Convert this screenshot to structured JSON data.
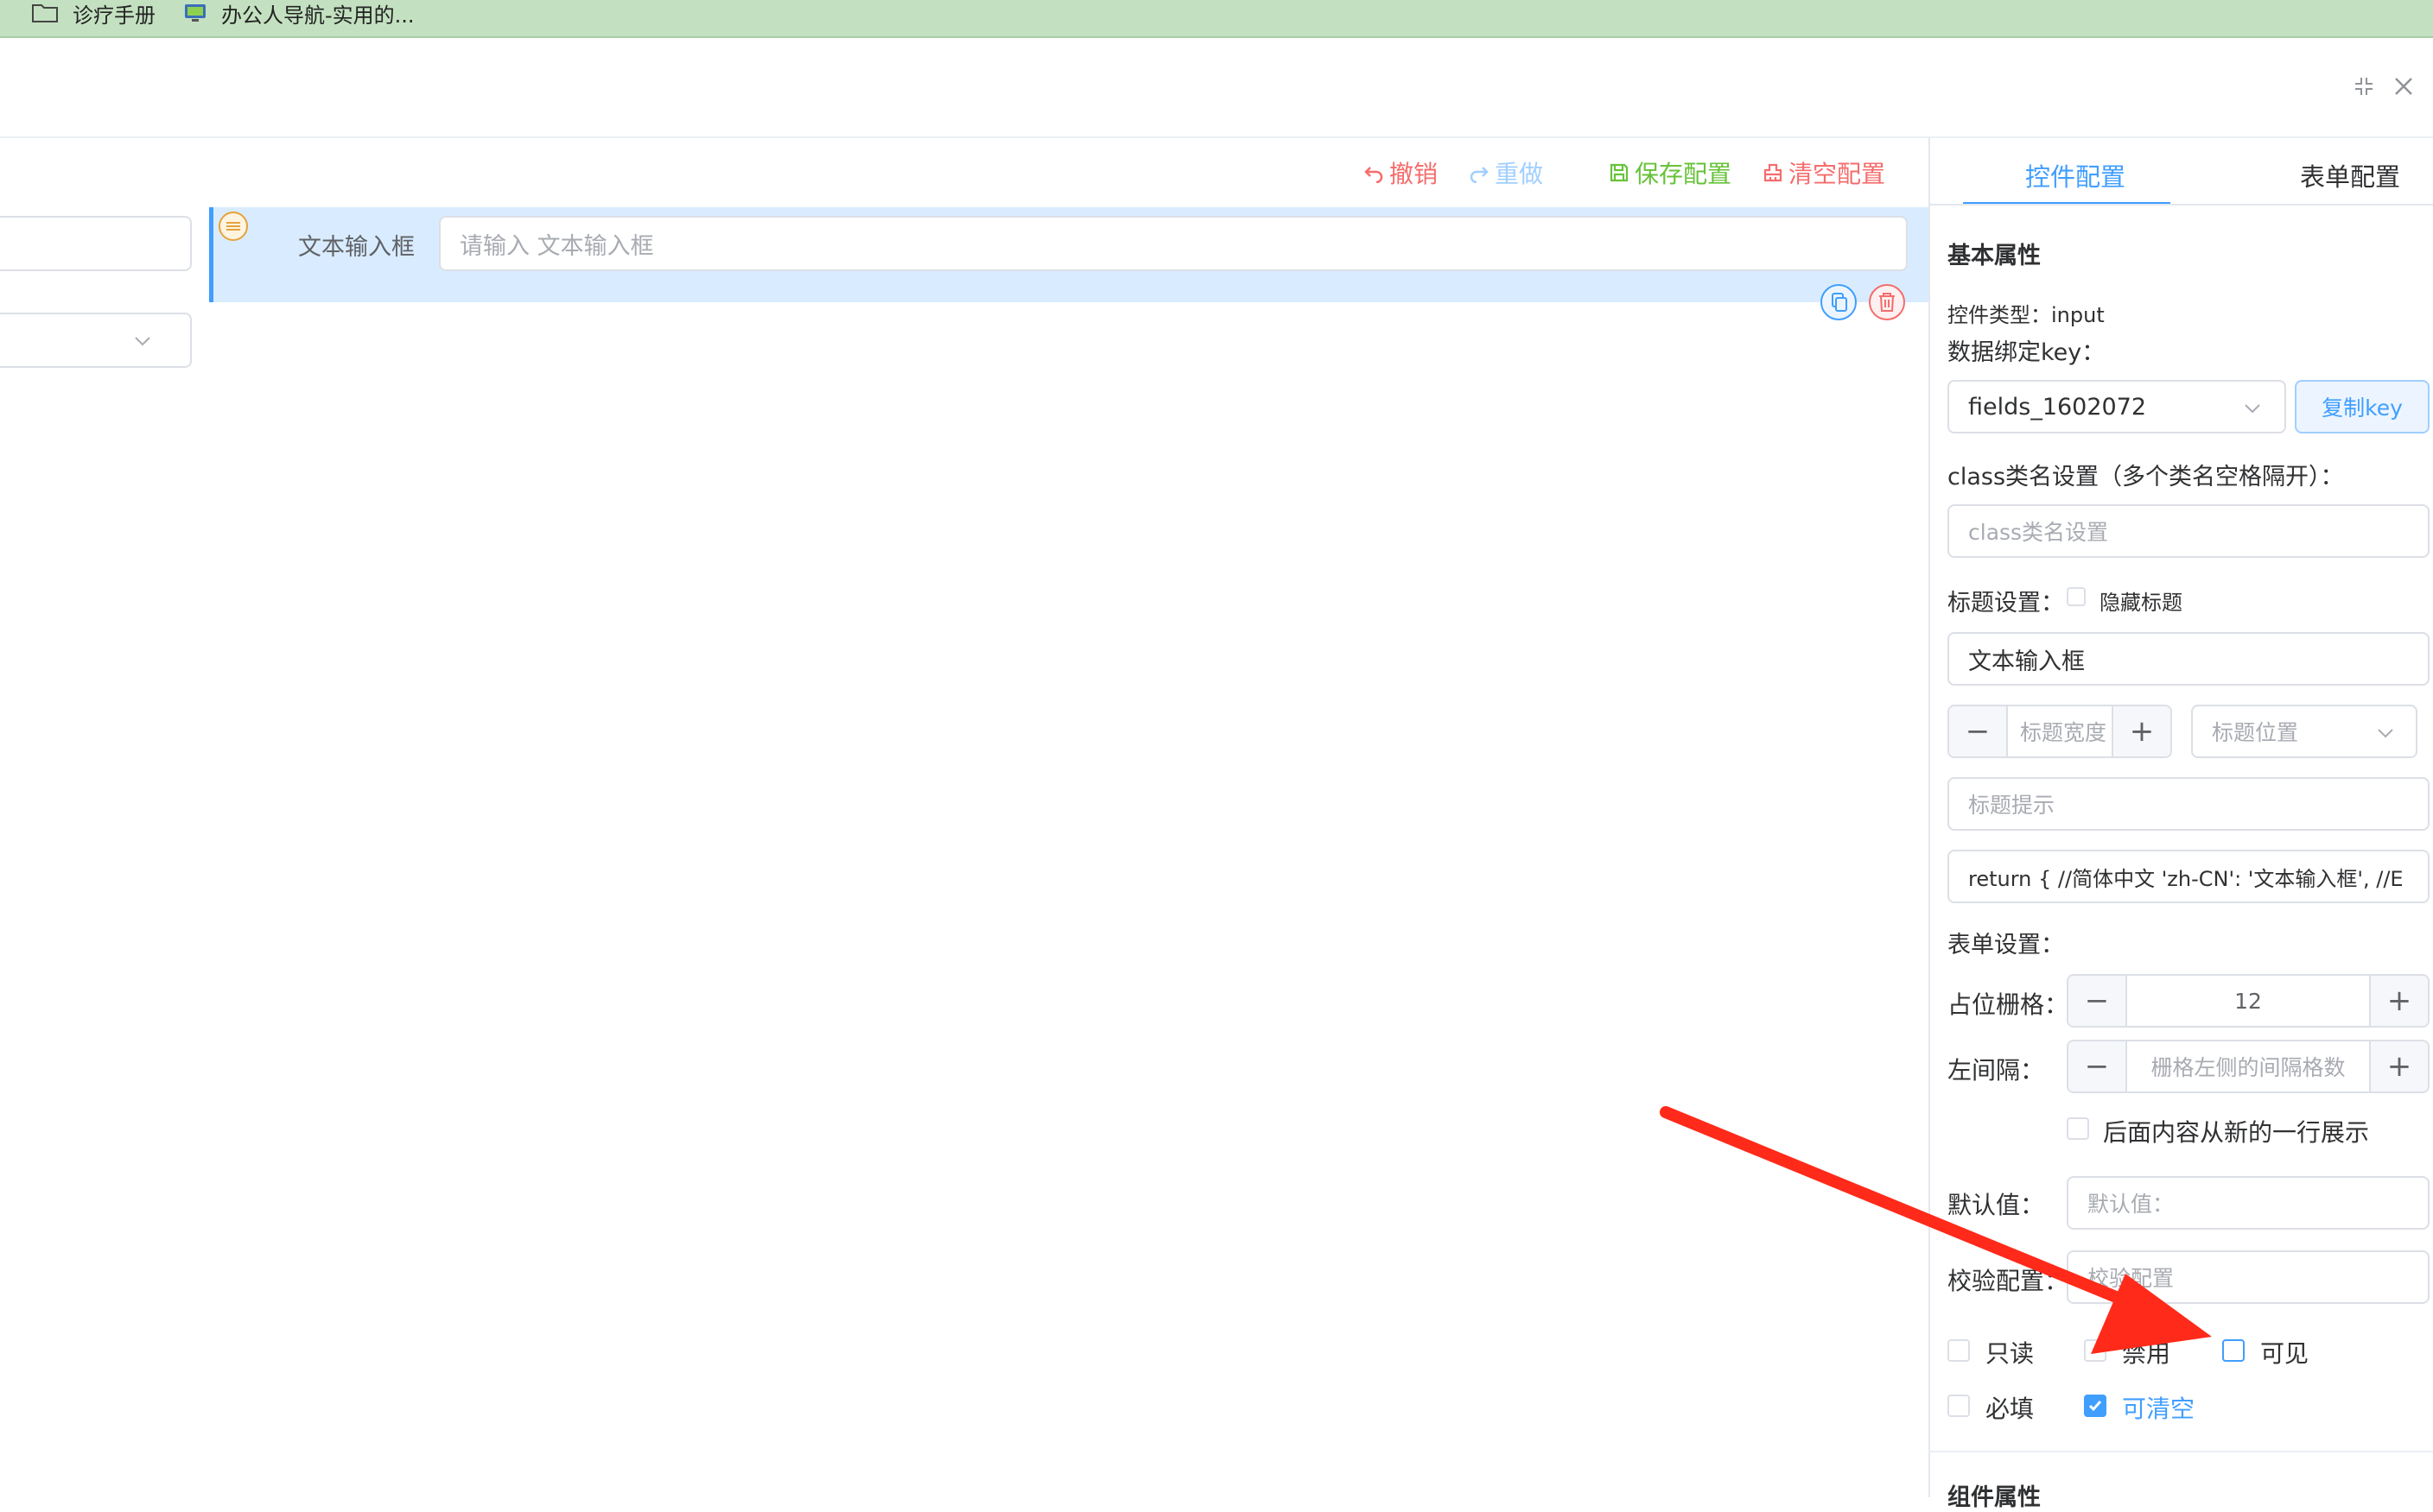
{
  "browser": {
    "bookmarks": [
      {
        "label": "诊疗手册",
        "icon": "folder-icon"
      },
      {
        "label": "办公人导航-实用的...",
        "icon": "site-favicon"
      }
    ]
  },
  "toolbar": {
    "undo": "撤销",
    "redo": "重做",
    "save": "保存配置",
    "clear": "清空配置"
  },
  "canvas": {
    "field_label": "文本输入框",
    "field_placeholder": "请输入 文本输入框"
  },
  "panel": {
    "tabs": [
      "控件配置",
      "表单配置"
    ],
    "active_tab": "控件配置",
    "basic_title": "基本属性",
    "control_type": "控件类型：input",
    "binding_key_label": "数据绑定key：",
    "binding_key_value": "fields_1602072",
    "copy_key": "复制key",
    "class_label": "class类名设置（多个类名空格隔开）：",
    "class_placeholder": "class类名设置",
    "title_label": "标题设置：",
    "hide_title": "隐藏标题",
    "title_value": "文本输入框",
    "title_width_placeholder": "标题宽度",
    "title_position_placeholder": "标题位置",
    "title_tip_placeholder": "标题提示",
    "i18n_value": "return {  //简体中文  'zh-CN': '文本输入框',  //E",
    "form_settings": "表单设置：",
    "grid_label": "占位栅格：",
    "grid_value": "12",
    "offset_label": "左间隔：",
    "offset_placeholder": "栅格左侧的间隔格数",
    "newline_label": "后面内容从新的一行展示",
    "default_label": "默认值：",
    "default_placeholder": "默认值：",
    "validate_label": "校验配置：",
    "validate_placeholder": "校验配置",
    "checkboxes": [
      {
        "label": "只读",
        "checked": false
      },
      {
        "label": "禁用",
        "checked": false
      },
      {
        "label": "可见",
        "checked": false
      },
      {
        "label": "必填",
        "checked": false
      },
      {
        "label": "可清空",
        "checked": true
      }
    ],
    "component_props": "组件属性"
  },
  "colors": {
    "primary": "#409eff",
    "danger": "#f56c6c",
    "success": "#67c23a",
    "annotation_arrow": "#ff2a1a"
  }
}
